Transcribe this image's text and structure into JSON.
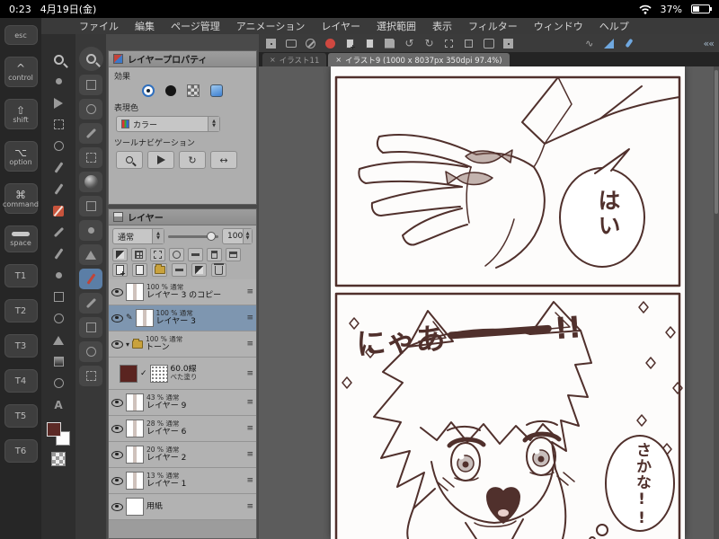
{
  "status_bar": {
    "time": "0:23",
    "date": "4月19日(金)",
    "battery_percent": "37%"
  },
  "menu_bar": {
    "items": [
      "ファイル",
      "編集",
      "ページ管理",
      "アニメーション",
      "レイヤー",
      "選択範囲",
      "表示",
      "フィルター",
      "ウィンドウ",
      "ヘルプ"
    ]
  },
  "edge_keyboard": {
    "esc": "esc",
    "modifiers": [
      {
        "glyph": "^",
        "label": "control"
      },
      {
        "glyph": "⇧",
        "label": "shift"
      },
      {
        "glyph": "⌥",
        "label": "option"
      },
      {
        "glyph": "⌘",
        "label": "command"
      }
    ],
    "space_label": "space",
    "touch_keys": [
      "T1",
      "T2",
      "T3",
      "T4",
      "T5",
      "T6"
    ]
  },
  "layer_property": {
    "title": "レイヤープロパティ",
    "effect_label": "効果",
    "expression_label": "表現色",
    "expression_value": "カラー",
    "tool_nav_label": "ツールナビゲーション"
  },
  "layer_panel": {
    "title": "レイヤー",
    "blend_mode": "通常",
    "opacity_value": "100",
    "layers": [
      {
        "opacity": "100 % 通常",
        "name": "レイヤー 3 のコピー"
      },
      {
        "opacity": "100 % 通常",
        "name": "レイヤー 3"
      },
      {
        "opacity": "100 % 通常",
        "name": "トーン"
      },
      {
        "tone_lines": "60.0線",
        "tone_fill": "べた塗り"
      },
      {
        "opacity": "43 % 通常",
        "name": "レイヤー 9"
      },
      {
        "opacity": "28 % 通常",
        "name": "レイヤー 6"
      },
      {
        "opacity": "20 % 通常",
        "name": "レイヤー 2"
      },
      {
        "opacity": "13 % 通常",
        "name": "レイヤー 1"
      },
      {
        "name": "用紙"
      }
    ]
  },
  "document": {
    "tabs": [
      {
        "label": "イラスト11"
      },
      {
        "label": "イラスト9 (1000 x 8037px 350dpi 97.4%)"
      }
    ]
  },
  "artwork": {
    "bubble_top": "はい",
    "shout_start": "にゃあ",
    "shout_dash": "ー",
    "shout_end": "!!",
    "bubble_bottom": "さかな!!"
  },
  "colors": {
    "selection_accent": "#7e96b0",
    "ink": "#50302c",
    "sub_tool_highlight": "#5b7ea6"
  }
}
